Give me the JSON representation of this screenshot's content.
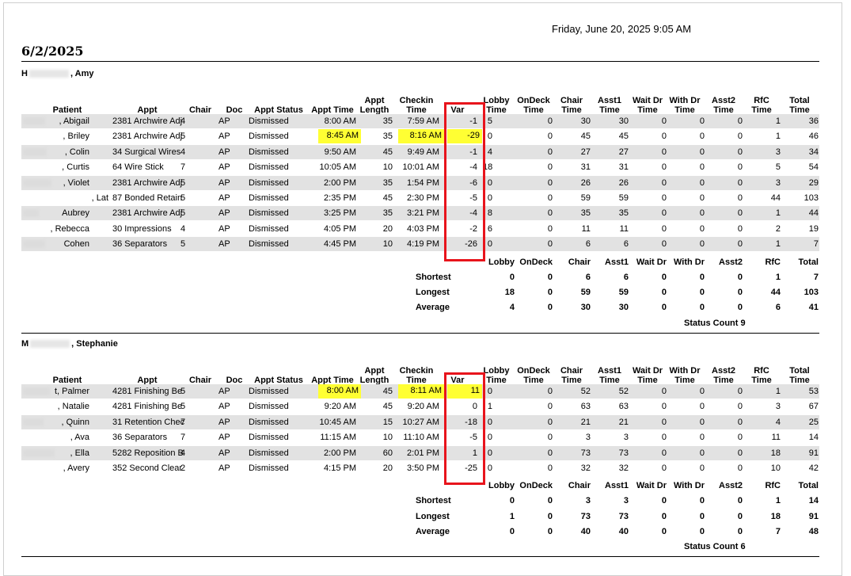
{
  "print_date": "Friday, June 20, 2025 9:05 AM",
  "report_date": "6/2/2025",
  "headers": {
    "patient": "Patient",
    "appt": "Appt",
    "chair": "Chair",
    "doc": "Doc",
    "appt_status": "Appt Status",
    "appt_time": "Appt Time",
    "appt_length": [
      "Appt",
      "Length"
    ],
    "checkin_time": [
      "Checkin",
      "Time"
    ],
    "var": "Var",
    "lobby_time": [
      "Lobby",
      "Time"
    ],
    "ondeck_time": [
      "OnDeck",
      "Time"
    ],
    "chair_time": [
      "Chair",
      "Time"
    ],
    "asst1_time": [
      "Asst1",
      "Time"
    ],
    "waitdr_time": [
      "Wait Dr",
      "Time"
    ],
    "withdr_time": [
      "With Dr",
      "Time"
    ],
    "asst2_time": [
      "Asst2",
      "Time"
    ],
    "rfc_time": [
      "RfC",
      "Time"
    ],
    "total_time": [
      "Total",
      "Time"
    ]
  },
  "summary_headers": [
    "Lobby",
    "OnDeck",
    "Chair",
    "Asst1",
    "Wait Dr",
    "With Dr",
    "Asst2",
    "RfC",
    "Total"
  ],
  "sections": [
    {
      "provider_initial": "H",
      "provider_rest": ", Amy",
      "rows": [
        {
          "patient": ", Abigail",
          "appt": "2381 Archwire Adj",
          "chair": "4",
          "doc": "AP",
          "status": "Dismissed",
          "appt_time": "8:00 AM",
          "length": "35",
          "checkin": "7:59 AM",
          "var": "-1",
          "lobby": "5",
          "ondeck": "0",
          "chairt": "30",
          "asst1": "30",
          "waitdr": "0",
          "withdr": "0",
          "asst2": "0",
          "rfc": "1",
          "total": "36"
        },
        {
          "patient": ", Briley",
          "appt": "2381 Archwire Adj",
          "chair": "5",
          "doc": "AP",
          "status": "Dismissed",
          "appt_time": "8:45 AM",
          "length": "35",
          "checkin": "8:16 AM",
          "var": "-29",
          "lobby": "0",
          "ondeck": "0",
          "chairt": "45",
          "asst1": "45",
          "waitdr": "0",
          "withdr": "0",
          "asst2": "0",
          "rfc": "1",
          "total": "46"
        },
        {
          "patient": ", Colin",
          "appt": "34 Surgical Wires",
          "chair": "4",
          "doc": "AP",
          "status": "Dismissed",
          "appt_time": "9:50 AM",
          "length": "45",
          "checkin": "9:49 AM",
          "var": "-1",
          "lobby": "4",
          "ondeck": "0",
          "chairt": "27",
          "asst1": "27",
          "waitdr": "0",
          "withdr": "0",
          "asst2": "0",
          "rfc": "3",
          "total": "34"
        },
        {
          "patient": ", Curtis",
          "appt": "64 Wire Stick",
          "chair": "7",
          "doc": "AP",
          "status": "Dismissed",
          "appt_time": "10:05 AM",
          "length": "10",
          "checkin": "10:01 AM",
          "var": "-4",
          "lobby": "18",
          "ondeck": "0",
          "chairt": "31",
          "asst1": "31",
          "waitdr": "0",
          "withdr": "0",
          "asst2": "0",
          "rfc": "5",
          "total": "54"
        },
        {
          "patient": ", Violet",
          "appt": "2381 Archwire Adj",
          "chair": "5",
          "doc": "AP",
          "status": "Dismissed",
          "appt_time": "2:00 PM",
          "length": "35",
          "checkin": "1:54 PM",
          "var": "-6",
          "lobby": "0",
          "ondeck": "0",
          "chairt": "26",
          "asst1": "26",
          "waitdr": "0",
          "withdr": "0",
          "asst2": "0",
          "rfc": "3",
          "total": "29"
        },
        {
          "patient": ", Lat",
          "appt": "87 Bonded Retain",
          "chair": "5",
          "doc": "AP",
          "status": "Dismissed",
          "appt_time": "2:35 PM",
          "length": "45",
          "checkin": "2:30 PM",
          "var": "-5",
          "lobby": "0",
          "ondeck": "0",
          "chairt": "59",
          "asst1": "59",
          "waitdr": "0",
          "withdr": "0",
          "asst2": "0",
          "rfc": "44",
          "total": "103"
        },
        {
          "patient": "Aubrey",
          "appt": "2381 Archwire Adj",
          "chair": "5",
          "doc": "AP",
          "status": "Dismissed",
          "appt_time": "3:25 PM",
          "length": "35",
          "checkin": "3:21 PM",
          "var": "-4",
          "lobby": "8",
          "ondeck": "0",
          "chairt": "35",
          "asst1": "35",
          "waitdr": "0",
          "withdr": "0",
          "asst2": "0",
          "rfc": "1",
          "total": "44"
        },
        {
          "patient": ", Rebecca",
          "appt": "30 Impressions",
          "chair": "4",
          "doc": "AP",
          "status": "Dismissed",
          "appt_time": "4:05 PM",
          "length": "20",
          "checkin": "4:03 PM",
          "var": "-2",
          "lobby": "6",
          "ondeck": "0",
          "chairt": "11",
          "asst1": "11",
          "waitdr": "0",
          "withdr": "0",
          "asst2": "0",
          "rfc": "2",
          "total": "19"
        },
        {
          "patient": "Cohen",
          "appt": "36 Separators",
          "chair": "5",
          "doc": "AP",
          "status": "Dismissed",
          "appt_time": "4:45 PM",
          "length": "10",
          "checkin": "4:19 PM",
          "var": "-26",
          "lobby": "0",
          "ondeck": "0",
          "chairt": "6",
          "asst1": "6",
          "waitdr": "0",
          "withdr": "0",
          "asst2": "0",
          "rfc": "1",
          "total": "7"
        }
      ],
      "summary": [
        {
          "label": "Shortest",
          "values": [
            "0",
            "0",
            "6",
            "6",
            "0",
            "0",
            "0",
            "1",
            "7"
          ]
        },
        {
          "label": "Longest",
          "values": [
            "18",
            "0",
            "59",
            "59",
            "0",
            "0",
            "0",
            "44",
            "103"
          ]
        },
        {
          "label": "Average",
          "values": [
            "4",
            "0",
            "30",
            "30",
            "0",
            "0",
            "0",
            "6",
            "41"
          ]
        }
      ],
      "status_count": "Status Count 9"
    },
    {
      "provider_initial": "M",
      "provider_rest": ", Stephanie",
      "rows": [
        {
          "patient": "t, Palmer",
          "appt": "4281 Finishing Be",
          "chair": "5",
          "doc": "AP",
          "status": "Dismissed",
          "appt_time": "8:00 AM",
          "length": "45",
          "checkin": "8:11 AM",
          "var": "11",
          "lobby": "0",
          "ondeck": "0",
          "chairt": "52",
          "asst1": "52",
          "waitdr": "0",
          "withdr": "0",
          "asst2": "0",
          "rfc": "1",
          "total": "53"
        },
        {
          "patient": ", Natalie",
          "appt": "4281 Finishing Be",
          "chair": "5",
          "doc": "AP",
          "status": "Dismissed",
          "appt_time": "9:20 AM",
          "length": "45",
          "checkin": "9:20 AM",
          "var": "0",
          "lobby": "1",
          "ondeck": "0",
          "chairt": "63",
          "asst1": "63",
          "waitdr": "0",
          "withdr": "0",
          "asst2": "0",
          "rfc": "3",
          "total": "67"
        },
        {
          "patient": ", Quinn",
          "appt": "31 Retention Chec",
          "chair": "7",
          "doc": "AP",
          "status": "Dismissed",
          "appt_time": "10:45 AM",
          "length": "15",
          "checkin": "10:27 AM",
          "var": "-18",
          "lobby": "0",
          "ondeck": "0",
          "chairt": "21",
          "asst1": "21",
          "waitdr": "0",
          "withdr": "0",
          "asst2": "0",
          "rfc": "4",
          "total": "25"
        },
        {
          "patient": ", Ava",
          "appt": "36 Separators",
          "chair": "7",
          "doc": "AP",
          "status": "Dismissed",
          "appt_time": "11:15 AM",
          "length": "10",
          "checkin": "11:10 AM",
          "var": "-5",
          "lobby": "0",
          "ondeck": "0",
          "chairt": "3",
          "asst1": "3",
          "waitdr": "0",
          "withdr": "0",
          "asst2": "0",
          "rfc": "11",
          "total": "14"
        },
        {
          "patient": ", Ella",
          "appt": "5282 Reposition B",
          "chair": "4",
          "doc": "AP",
          "status": "Dismissed",
          "appt_time": "2:00 PM",
          "length": "60",
          "checkin": "2:01 PM",
          "var": "1",
          "lobby": "0",
          "ondeck": "0",
          "chairt": "73",
          "asst1": "73",
          "waitdr": "0",
          "withdr": "0",
          "asst2": "0",
          "rfc": "18",
          "total": "91"
        },
        {
          "patient": ", Avery",
          "appt": "352 Second Clear",
          "chair": "2",
          "doc": "AP",
          "status": "Dismissed",
          "appt_time": "4:15 PM",
          "length": "20",
          "checkin": "3:50 PM",
          "var": "-25",
          "lobby": "0",
          "ondeck": "0",
          "chairt": "32",
          "asst1": "32",
          "waitdr": "0",
          "withdr": "0",
          "asst2": "0",
          "rfc": "10",
          "total": "42"
        }
      ],
      "summary": [
        {
          "label": "Shortest",
          "values": [
            "0",
            "0",
            "3",
            "3",
            "0",
            "0",
            "0",
            "1",
            "14"
          ]
        },
        {
          "label": "Longest",
          "values": [
            "1",
            "0",
            "73",
            "73",
            "0",
            "0",
            "0",
            "18",
            "91"
          ]
        },
        {
          "label": "Average",
          "values": [
            "0",
            "0",
            "40",
            "40",
            "0",
            "0",
            "0",
            "7",
            "48"
          ]
        }
      ],
      "status_count": "Status Count 6"
    }
  ]
}
